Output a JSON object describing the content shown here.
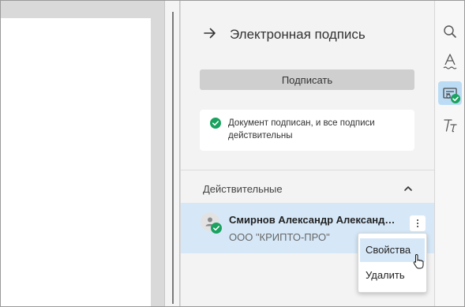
{
  "panel": {
    "title": "Электронная подпись",
    "sign_button_label": "Подписать",
    "status_text": "Документ подписан, и все подписи действительны"
  },
  "section": {
    "title": "Действительные"
  },
  "signer": {
    "name": "Смирнов Александр Александрович",
    "organization": "ООО \"КРИПТО-ПРО\""
  },
  "context_menu": {
    "items": [
      {
        "label": "Свойства",
        "active": true
      },
      {
        "label": "Удалить",
        "active": false
      }
    ]
  },
  "toolbar": {
    "tools": [
      {
        "icon": "search-icon",
        "active": false
      },
      {
        "icon": "text-style-icon",
        "active": false
      },
      {
        "icon": "signature-certificate-icon",
        "active": true
      },
      {
        "icon": "italic-text-icon",
        "active": false
      }
    ]
  },
  "colors": {
    "accent_green": "#1aa260",
    "selection_blue": "#d6e8f8",
    "toolbar_active": "#bcdcf5"
  }
}
